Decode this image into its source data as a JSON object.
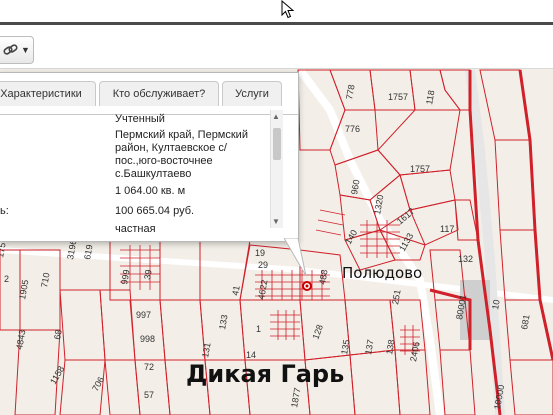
{
  "tabs": [
    {
      "label": "Характеристики"
    },
    {
      "label": "Кто обслуживает?"
    },
    {
      "label": "Услуги"
    }
  ],
  "info": {
    "status": "Учтенный",
    "address": [
      "Пермский край, Пермский",
      "район, Култаевское с/",
      "пос.,юго-восточнее",
      "с.Башкултаево"
    ],
    "area": "1 064.00 кв. м",
    "cost_label_fragment": "ь:",
    "cost": "100 665.04 руб.",
    "ownership": "частная"
  },
  "map": {
    "places": [
      {
        "name": "Полюдово"
      },
      {
        "name": "Дикая Гарь"
      }
    ],
    "parcel_numbers": [
      "778",
      "1757",
      "118",
      "776",
      "1757",
      "960",
      "1320",
      "1617",
      "117",
      "140",
      "1133",
      "132",
      "19",
      "29",
      "488",
      "251",
      "4622",
      "999",
      "39",
      "997",
      "998",
      "133",
      "1",
      "128",
      "72",
      "135",
      "137",
      "138",
      "2406",
      "131",
      "14",
      "57",
      "710",
      "3196",
      "619",
      "1905",
      "1158",
      "706",
      "68",
      "4843",
      "1757",
      "2",
      "41",
      "1877",
      "10",
      "80001",
      "10000",
      "681"
    ]
  },
  "colors": {
    "parcel_line": "#d0202a",
    "popup_bg": "#ffffff",
    "map_bg": "#f3efe8"
  },
  "icons": [
    "link-tool-icon",
    "chevron-down-icon",
    "mouse-cursor-icon",
    "selected-parcel-marker-icon"
  ]
}
